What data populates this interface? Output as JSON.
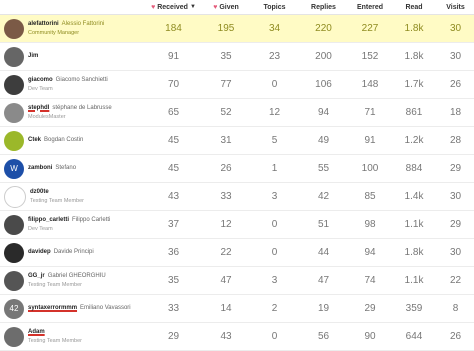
{
  "columns": {
    "received": "Received",
    "given": "Given",
    "topics": "Topics",
    "replies": "Replies",
    "entered": "Entered",
    "read": "Read",
    "visits": "Visits"
  },
  "colors": {
    "highlight": "#fffbc5",
    "heart": "#e45b7a",
    "underline": "#d4322b"
  },
  "rows": [
    {
      "username": "alefattorini",
      "name": "Alessio Fattorini",
      "title": "Community Manager",
      "received": "184",
      "given": "195",
      "topics": "34",
      "replies": "220",
      "entered": "227",
      "read": "1.8k",
      "visits": "30",
      "avatar_color": "#7b5a46",
      "avatar_letter": ""
    },
    {
      "username": "Jim",
      "name": "",
      "title": "",
      "received": "91",
      "given": "35",
      "topics": "23",
      "replies": "200",
      "entered": "152",
      "read": "1.8k",
      "visits": "30",
      "avatar_color": "#666",
      "avatar_letter": ""
    },
    {
      "username": "giacomo",
      "name": "Giacomo Sanchietti",
      "title": "Dev Team",
      "received": "70",
      "given": "77",
      "topics": "0",
      "replies": "106",
      "entered": "148",
      "read": "1.7k",
      "visits": "26",
      "avatar_color": "#3d3d3d",
      "avatar_letter": ""
    },
    {
      "username": "stephdl",
      "name": "stéphane de Labrusse",
      "title": "ModulesMaster",
      "received": "65",
      "given": "52",
      "topics": "12",
      "replies": "94",
      "entered": "71",
      "read": "861",
      "visits": "18",
      "avatar_color": "#8a8a8a",
      "avatar_letter": ""
    },
    {
      "username": "Ctek",
      "name": "Bogdan Costin",
      "title": "",
      "received": "45",
      "given": "31",
      "topics": "5",
      "replies": "49",
      "entered": "91",
      "read": "1.2k",
      "visits": "28",
      "avatar_color": "#9bb82a",
      "avatar_letter": ""
    },
    {
      "username": "zamboni",
      "name": "Stefano",
      "title": "",
      "received": "45",
      "given": "26",
      "topics": "1",
      "replies": "55",
      "entered": "100",
      "read": "884",
      "visits": "29",
      "avatar_color": "#1d4fa8",
      "avatar_letter": "W"
    },
    {
      "username": "dz00te",
      "name": "",
      "title": "Testing Team Member",
      "received": "43",
      "given": "33",
      "topics": "3",
      "replies": "42",
      "entered": "85",
      "read": "1.4k",
      "visits": "30",
      "avatar_color": "#ffffff",
      "avatar_letter": ""
    },
    {
      "username": "filippo_carletti",
      "name": "Filippo Carletti",
      "title": "Dev Team",
      "received": "37",
      "given": "12",
      "topics": "0",
      "replies": "51",
      "entered": "98",
      "read": "1.1k",
      "visits": "29",
      "avatar_color": "#4a4a4a",
      "avatar_letter": ""
    },
    {
      "username": "davidep",
      "name": "Davide Principi",
      "title": "",
      "received": "36",
      "given": "22",
      "topics": "0",
      "replies": "44",
      "entered": "94",
      "read": "1.8k",
      "visits": "30",
      "avatar_color": "#2a2a2a",
      "avatar_letter": ""
    },
    {
      "username": "GG_jr",
      "name": "Gabriel GHEORGHIU",
      "title": "Testing Team Member",
      "received": "35",
      "given": "47",
      "topics": "3",
      "replies": "47",
      "entered": "74",
      "read": "1.1k",
      "visits": "22",
      "avatar_color": "#555",
      "avatar_letter": ""
    },
    {
      "username": "syntaxerrormmm",
      "name": "Emiliano Vavassori",
      "title": "",
      "received": "33",
      "given": "14",
      "topics": "2",
      "replies": "19",
      "entered": "29",
      "read": "359",
      "visits": "8",
      "avatar_color": "#777",
      "avatar_letter": "42"
    },
    {
      "username": "Adam",
      "name": "",
      "title": "Testing Team Member",
      "received": "29",
      "given": "43",
      "topics": "0",
      "replies": "56",
      "entered": "90",
      "read": "644",
      "visits": "26",
      "avatar_color": "#6d6d6d",
      "avatar_letter": ""
    }
  ]
}
